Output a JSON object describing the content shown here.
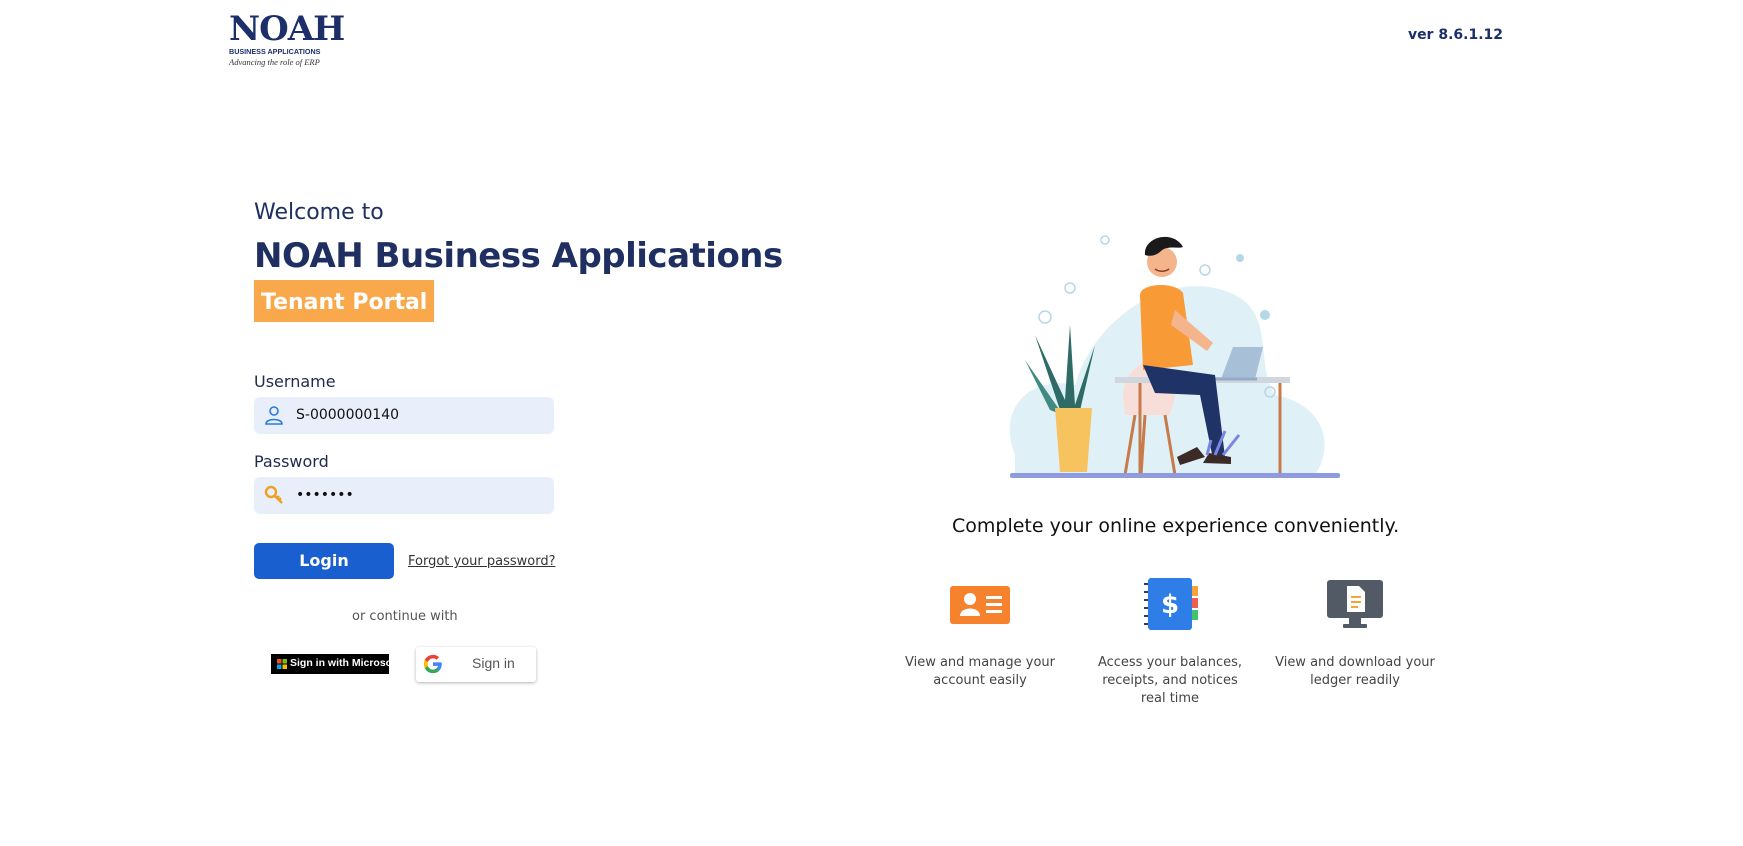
{
  "header": {
    "logo_name": "NOAH",
    "logo_subtitle": "BUSINESS APPLICATIONS",
    "logo_tagline": "Advancing the role of ERP",
    "version": "ver 8.6.1.12"
  },
  "login": {
    "welcome": "Welcome to",
    "app_name": "NOAH Business Applications",
    "portal": "Tenant Portal",
    "username_label": "Username",
    "username_value": "S-0000000140",
    "password_label": "Password",
    "password_value": "•••••••",
    "login_button": "Login",
    "forgot_link": "Forgot your password?",
    "or_continue": "or continue with",
    "microsoft_button": "Sign in with Microsoft",
    "google_button": "Sign in"
  },
  "promo": {
    "tagline": "Complete your online experience conveniently.",
    "features": [
      {
        "icon": "account-card-icon",
        "text": "View and manage your account easily"
      },
      {
        "icon": "balance-notebook-icon",
        "text": "Access your balances, receipts, and notices real time"
      },
      {
        "icon": "ledger-monitor-icon",
        "text": "View and download your ledger readily"
      }
    ]
  },
  "colors": {
    "brand_navy": "#1f2f61",
    "accent_orange": "#f9a94b",
    "primary_blue": "#1a5fd0",
    "input_bg": "#e8effb"
  }
}
